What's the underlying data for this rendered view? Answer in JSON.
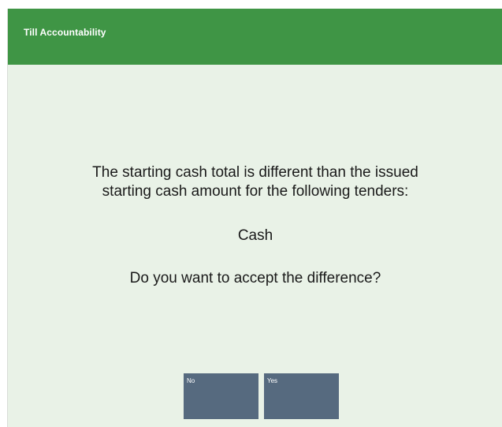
{
  "window": {
    "title": "Till Accountability"
  },
  "message": {
    "line1": "The starting cash total is different than the issued",
    "line2": "starting cash amount for the following tenders:",
    "tender": "Cash",
    "question": "Do you want to accept the difference?"
  },
  "buttons": {
    "no_label": "No",
    "yes_label": "Yes"
  },
  "colors": {
    "titlebar": "#3f9545",
    "background": "#e9f2e7",
    "button": "#566a7f"
  }
}
